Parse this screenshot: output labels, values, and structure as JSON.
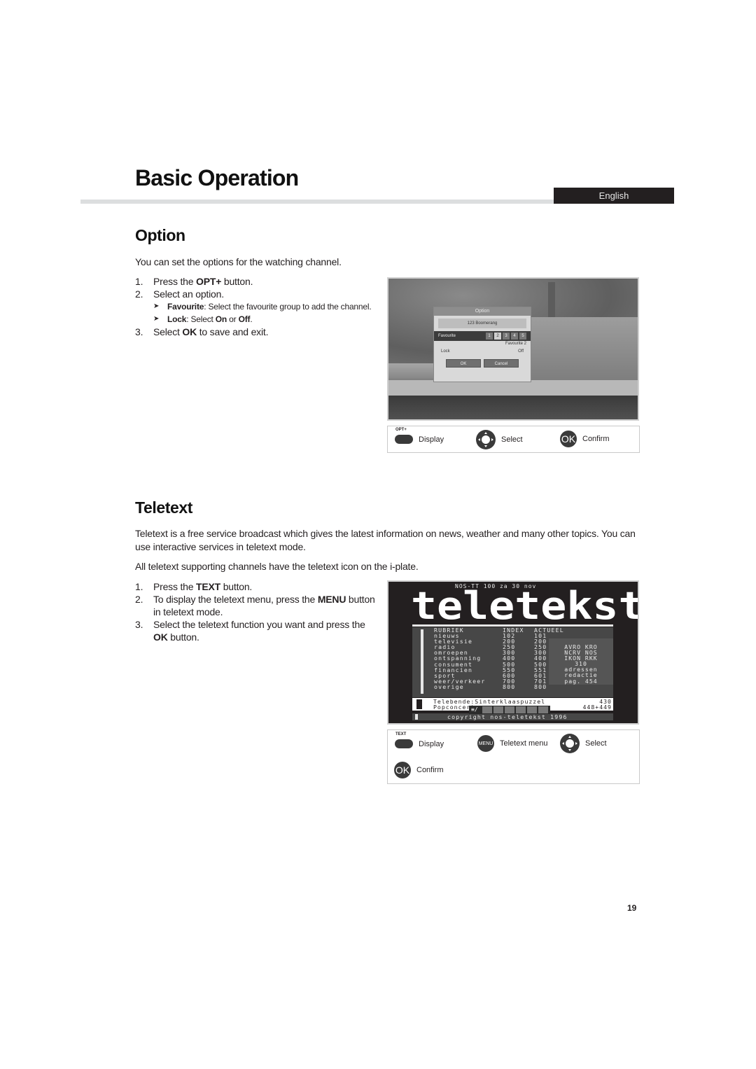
{
  "header": {
    "title": "Basic Operation",
    "language": "English"
  },
  "option_section": {
    "title": "Option",
    "intro": "You can set the options for the watching channel.",
    "steps": [
      {
        "num": "1.",
        "pre": "Press the ",
        "bold": "OPT+",
        "post": " button."
      },
      {
        "num": "2.",
        "text": "Select an option."
      },
      {
        "num": "3.",
        "pre": "Select ",
        "bold": "OK",
        "post": " to save and exit."
      }
    ],
    "sub_items": [
      {
        "bold": "Favourite",
        "text": ": Select the favourite group to add the channel."
      },
      {
        "bold": "Lock",
        "text": ": Select ",
        "bold2": "On",
        "mid": " or ",
        "bold3": "Off",
        "end": "."
      }
    ],
    "screen": {
      "dialog_title": "Option",
      "channel": "123 Boomerang",
      "favourite_label": "Favourite",
      "favourite_numbers": [
        "1",
        "2",
        "3",
        "4",
        "5"
      ],
      "favourite_selected": "Favourite 2",
      "lock_label": "Lock",
      "lock_value": "Off",
      "ok_button": "OK",
      "cancel_button": "Cancel"
    },
    "legend": [
      {
        "icon": "opt-plus-button-icon",
        "cap": "OPT+",
        "label": "Display"
      },
      {
        "icon": "dpad-icon",
        "label": "Select"
      },
      {
        "icon": "ok-button-icon",
        "glyph": "OK",
        "label": "Confirm"
      }
    ]
  },
  "teletext_section": {
    "title": "Teletext",
    "intro1": "Teletext is a free service broadcast which gives the latest information on news, weather and many other topics. You can use interactive services in teletext mode.",
    "intro2": "All teletext supporting channels have the teletext icon on the i-plate.",
    "steps": [
      {
        "num": "1.",
        "pre": "Press the ",
        "bold": "TEXT",
        "post": " button."
      },
      {
        "num": "2.",
        "pre": "To display the teletext menu, press the ",
        "bold": "MENU",
        "post": " button in teletext mode."
      },
      {
        "num": "3.",
        "pre": "Select the teletext function you want and press the ",
        "bold": "OK",
        "post": " button."
      }
    ],
    "screen": {
      "header": "NOS-TT  100 za 30 nov",
      "logo": "teletekst",
      "columns": [
        "RUBRIEK",
        "INDEX",
        "ACTUEEL"
      ],
      "rows": [
        [
          "nieuws",
          "102",
          "101"
        ],
        [
          "televisie",
          "200",
          "200"
        ],
        [
          "radio",
          "250",
          "250"
        ],
        [
          "omroepen",
          "300",
          "300"
        ],
        [
          "ontspanning",
          "400",
          "400"
        ],
        [
          "consument",
          "500",
          "500"
        ],
        [
          "financien",
          "550",
          "551"
        ],
        [
          "sport",
          "600",
          "601"
        ],
        [
          "weer/verkeer",
          "700",
          "701"
        ],
        [
          "overige",
          "800",
          "800"
        ]
      ],
      "side_box": [
        "AVRO KRO",
        "NCRV NOS",
        "IKON RKK",
        "310",
        "adressen",
        "redactie",
        "pag. 454"
      ],
      "news": [
        {
          "text": "Telebende:Sinterklaaspuzzel",
          "page": "430"
        },
        {
          "text": "Popconcerten",
          "page": "448+449"
        }
      ],
      "toolbar_glyph": "≡/",
      "copyright": "copyright nos-teletekst 1996"
    },
    "legend": [
      {
        "icon": "text-button-icon",
        "cap": "TEXT",
        "label": "Display"
      },
      {
        "icon": "menu-button-icon",
        "glyph": "MENU",
        "label": "Teletext menu"
      },
      {
        "icon": "dpad-icon",
        "label": "Select"
      },
      {
        "icon": "ok-button-icon",
        "glyph": "OK",
        "label": "Confirm"
      }
    ]
  },
  "page_number": "19"
}
